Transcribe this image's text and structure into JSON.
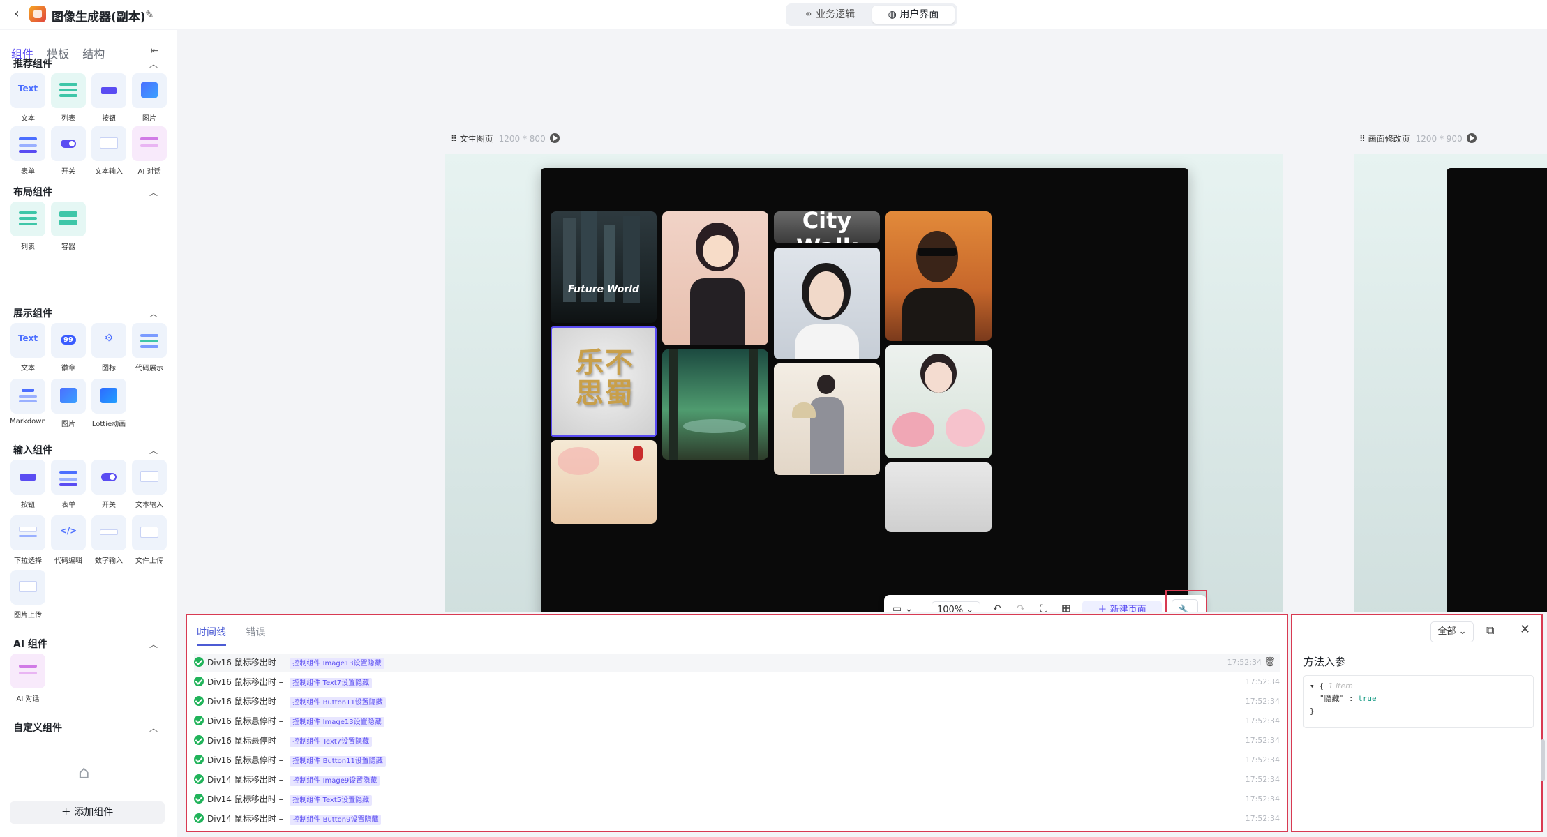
{
  "header": {
    "title": "图像生成器(副本)",
    "modes": [
      "业务逻辑",
      "用户界面"
    ],
    "active_mode": "用户界面"
  },
  "left_panel": {
    "tabs": [
      "组件",
      "模板",
      "结构"
    ],
    "sections": {
      "recommended": {
        "title": "推荐组件",
        "items": [
          "文本",
          "列表",
          "按钮",
          "图片",
          "表单",
          "开关",
          "文本输入",
          "AI 对话"
        ]
      },
      "layout": {
        "title": "布局组件",
        "items": [
          "列表",
          "容器"
        ]
      },
      "display": {
        "title": "展示组件",
        "items": [
          "文本",
          "徽章",
          "图标",
          "代码展示",
          "Markdown",
          "图片",
          "Lottie动画"
        ]
      },
      "input": {
        "title": "输入组件",
        "items": [
          "按钮",
          "表单",
          "开关",
          "文本输入",
          "下拉选择",
          "代码编辑",
          "数字输入",
          "文件上传",
          "图片上传"
        ]
      },
      "ai": {
        "title": "AI 组件",
        "items": [
          "AI 对话"
        ]
      },
      "custom": {
        "title": "自定义组件"
      }
    },
    "tile_text": "Text",
    "badge_number": "99",
    "add_button": "添加组件"
  },
  "canvas": {
    "page1": {
      "name": "文生图页",
      "size": "1200 * 800"
    },
    "page2": {
      "name": "画面修改页",
      "size": "1200 * 900"
    },
    "images": {
      "future": "Future World",
      "citywalk": "City Walk",
      "chinese": "乐不思蜀"
    },
    "toolbar": {
      "zoom": "100%",
      "new_page": "新建页面"
    }
  },
  "log_panel": {
    "tabs": [
      "时间线",
      "错误"
    ],
    "rows": [
      {
        "source": "Div16 鼠标移出时",
        "tag": "控制组件 Image13设置隐藏",
        "time": "17:52:34"
      },
      {
        "source": "Div16 鼠标移出时",
        "tag": "控制组件 Text7设置隐藏",
        "time": "17:52:34"
      },
      {
        "source": "Div16 鼠标移出时",
        "tag": "控制组件 Button11设置隐藏",
        "time": "17:52:34"
      },
      {
        "source": "Div16 鼠标悬停时",
        "tag": "控制组件 Image13设置隐藏",
        "time": "17:52:34"
      },
      {
        "source": "Div16 鼠标悬停时",
        "tag": "控制组件 Text7设置隐藏",
        "time": "17:52:34"
      },
      {
        "source": "Div16 鼠标悬停时",
        "tag": "控制组件 Button11设置隐藏",
        "time": "17:52:34"
      },
      {
        "source": "Div14 鼠标移出时",
        "tag": "控制组件 Image9设置隐藏",
        "time": "17:52:34"
      },
      {
        "source": "Div14 鼠标移出时",
        "tag": "控制组件 Text5设置隐藏",
        "time": "17:52:34"
      },
      {
        "source": "Div14 鼠标移出时",
        "tag": "控制组件 Button9设置隐藏",
        "time": "17:52:34"
      }
    ]
  },
  "params_panel": {
    "filter": "全部",
    "title": "方法入参",
    "json_meta": "1 item",
    "json_key": "\"隐藏\"",
    "json_value": "true"
  }
}
